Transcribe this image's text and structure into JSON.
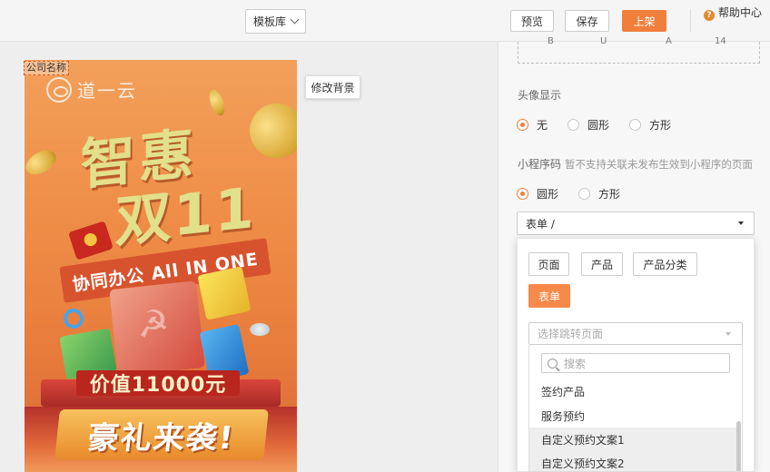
{
  "toolbar": {
    "template_library": "模板库",
    "preview": "预览",
    "save": "保存",
    "publish": "上架",
    "help": "帮助中心"
  },
  "canvas": {
    "company_name_tag": "公司名称",
    "change_background": "修改背景",
    "poster": {
      "logo_text": "道一云",
      "title_line1": "智惠",
      "title_line2": "双11",
      "ribbon": "协同办公 All IN ONE",
      "value": "价值11000元",
      "gift": "豪礼来袭!"
    }
  },
  "panel": {
    "font_options": [
      "B",
      "U",
      "A",
      "14"
    ],
    "avatar_display": {
      "label": "头像显示",
      "options": [
        "无",
        "圆形",
        "方形"
      ],
      "selected": "无"
    },
    "mini_program_code": {
      "label": "小程序码",
      "hint": "暂不支持关联未发布生效到小程序的页面",
      "options": [
        "圆形",
        "方形"
      ],
      "selected": "圆形",
      "link_select_value": "表单 /",
      "link_types": [
        "页面",
        "产品",
        "产品分类",
        "表单"
      ],
      "active_link_type": "表单",
      "jump_select_placeholder": "选择跳转页面",
      "search_placeholder": "搜索",
      "list_items": [
        "签约产品",
        "服务预约",
        "自定义预约文案1",
        "自定义预约文案2"
      ]
    }
  },
  "colors": {
    "accent": "#f07f3c",
    "poster_bg": "#ee8a45"
  }
}
